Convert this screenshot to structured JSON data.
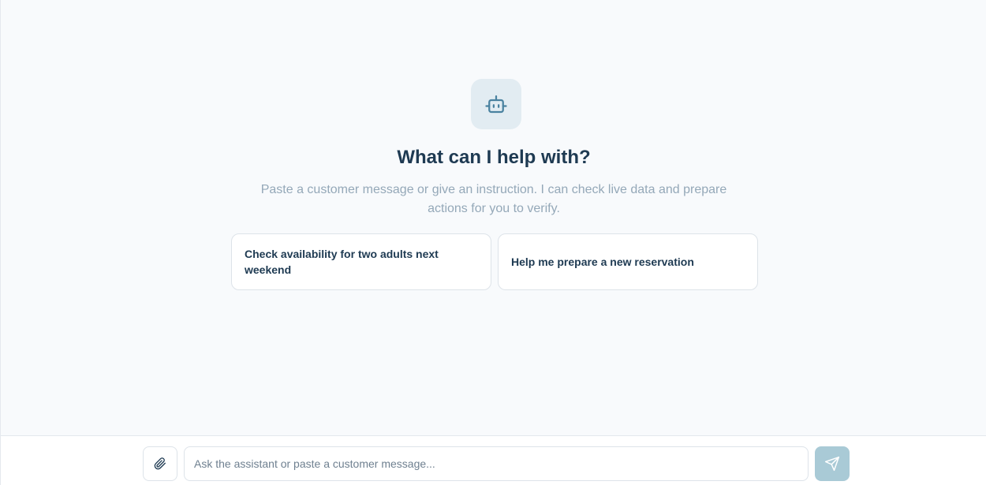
{
  "empty_state": {
    "icon": "bot-icon",
    "title": "What can I help with?",
    "subtitle": "Paste a customer message or give an instruction. I can check live data and prepare actions for you to verify."
  },
  "suggestions": [
    {
      "label": "Check availability for two adults next weekend"
    },
    {
      "label": "Help me prepare a new reservation"
    }
  ],
  "composer": {
    "attach_icon": "paperclip-icon",
    "input_placeholder": "Ask the assistant or paste a customer message...",
    "input_value": "",
    "send_icon": "send-icon",
    "send_enabled": false
  },
  "colors": {
    "background": "#f8fafc",
    "heading": "#1e3a52",
    "muted_text": "#94a8b8",
    "icon_accent": "#4a82a0",
    "icon_badge_bg": "#e2ecf2",
    "send_button_disabled": "#a9cad6"
  }
}
